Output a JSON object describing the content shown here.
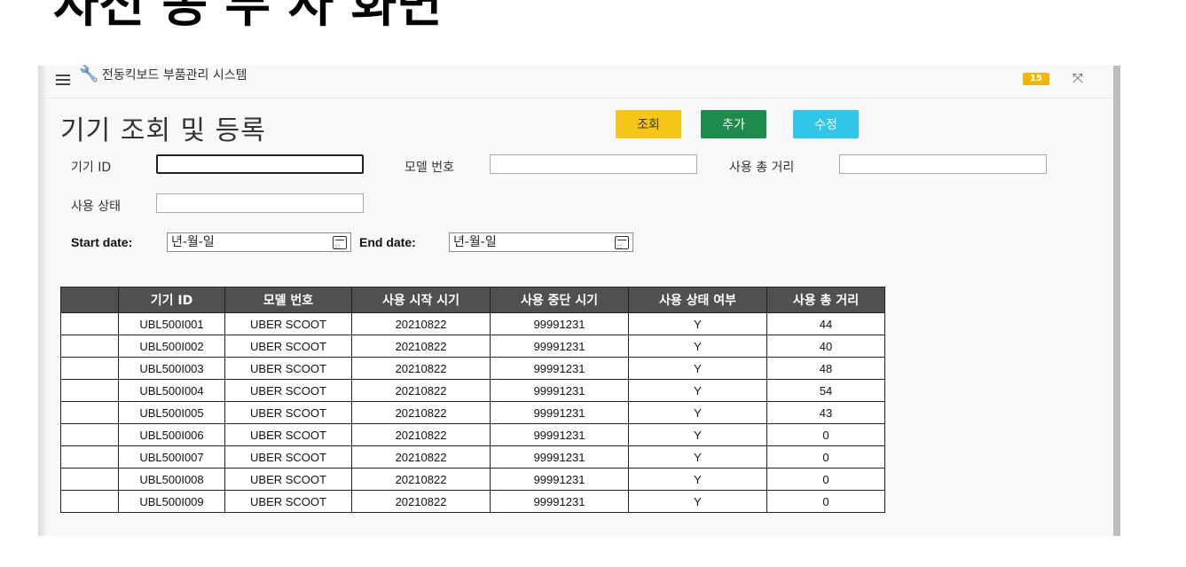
{
  "top_banner_text": "자전 동 부 사 화면",
  "header": {
    "menu_icon": "hamburger-icon",
    "logo_icon": "wrench-icon",
    "app_title": "전동킥보드 부품관리 시스템",
    "badge_count": "15",
    "expand_icon": "expand-icon"
  },
  "page": {
    "title": "기기 조회 및 등록",
    "buttons": {
      "search": "조회",
      "add": "추가",
      "edit": "수정"
    },
    "colors": {
      "search": "#f5c518",
      "add": "#1e8a4c",
      "edit": "#2fc6e8",
      "badge": "#f5b400"
    }
  },
  "form": {
    "device_id_label": "기기 ID",
    "device_id_value": "",
    "model_no_label": "모델 번호",
    "model_no_value": "",
    "total_distance_label": "사용 총 거리",
    "total_distance_value": "",
    "status_label": "사용 상태",
    "status_value": "",
    "start_date_label": "Start date:",
    "start_date_placeholder": "년-월-일",
    "end_date_label": "End date:",
    "end_date_placeholder": "년-월-일"
  },
  "table": {
    "columns": [
      "",
      "기기 ID",
      "모델 번호",
      "사용 시작 시기",
      "사용 중단 시기",
      "사용 상태 여부",
      "사용 총 거리"
    ],
    "rows": [
      [
        "",
        "UBL500I001",
        "UBER SCOOT",
        "20210822",
        "99991231",
        "Y",
        "44"
      ],
      [
        "",
        "UBL500I002",
        "UBER SCOOT",
        "20210822",
        "99991231",
        "Y",
        "40"
      ],
      [
        "",
        "UBL500I003",
        "UBER SCOOT",
        "20210822",
        "99991231",
        "Y",
        "48"
      ],
      [
        "",
        "UBL500I004",
        "UBER SCOOT",
        "20210822",
        "99991231",
        "Y",
        "54"
      ],
      [
        "",
        "UBL500I005",
        "UBER SCOOT",
        "20210822",
        "99991231",
        "Y",
        "43"
      ],
      [
        "",
        "UBL500I006",
        "UBER SCOOT",
        "20210822",
        "99991231",
        "Y",
        "0"
      ],
      [
        "",
        "UBL500I007",
        "UBER SCOOT",
        "20210822",
        "99991231",
        "Y",
        "0"
      ],
      [
        "",
        "UBL500I008",
        "UBER SCOOT",
        "20210822",
        "99991231",
        "Y",
        "0"
      ],
      [
        "",
        "UBL500I009",
        "UBER SCOOT",
        "20210822",
        "99991231",
        "Y",
        "0"
      ]
    ]
  }
}
